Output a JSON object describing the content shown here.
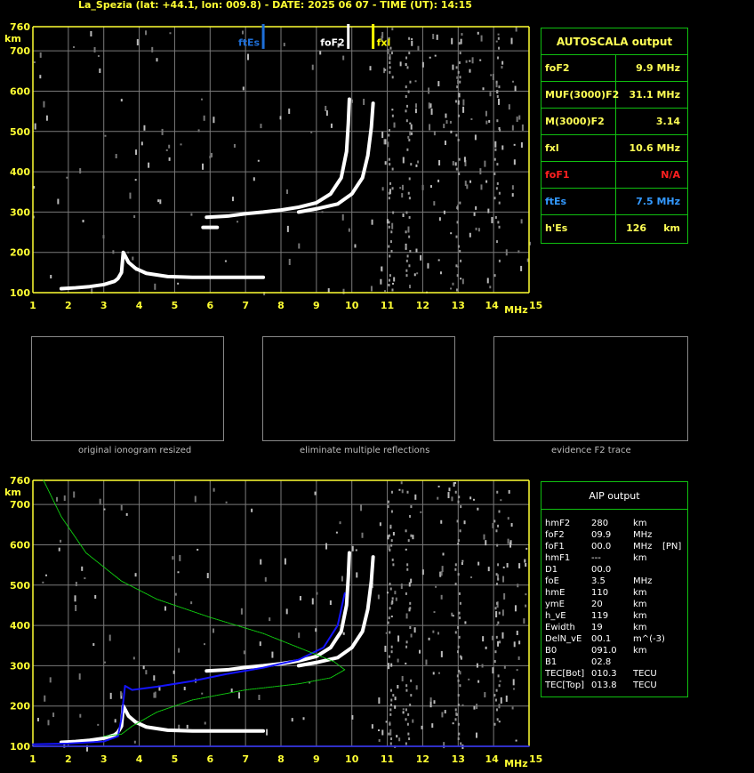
{
  "title": "La_Spezia (lat: +44.1, lon: 009.8) - DATE: 2025 06 07 - TIME (UT): 14:15",
  "colors": {
    "axis": "#ffff33",
    "grid": "#7a7a7a",
    "panel_border": "#10c010",
    "fte_marker": "#1e6fd9",
    "fof2_marker": "#ffffff",
    "fxl_marker": "#ffff00",
    "aip_profile": "#1414ff",
    "aip_model": "#10d010"
  },
  "axes": {
    "x_ticks": [
      "1",
      "2",
      "3",
      "4",
      "5",
      "6",
      "7",
      "8",
      "9",
      "10",
      "11",
      "12",
      "13",
      "14",
      "15"
    ],
    "x_unit": "MHz",
    "y_ticks": [
      "760",
      "700",
      "600",
      "500",
      "400",
      "300",
      "200",
      "100"
    ],
    "y_unit": "km"
  },
  "markers": {
    "ftEs": "ftEs",
    "foF2": "foF2",
    "fxl": "fxl"
  },
  "autoscala": {
    "title": "AUTOSCALA output",
    "rows": [
      {
        "label": "foF2",
        "value": "9.9 MHz",
        "color": "#ffff55"
      },
      {
        "label": "MUF(3000)F2",
        "value": "31.1 MHz",
        "color": "#ffff55"
      },
      {
        "label": "M(3000)F2",
        "value": "3.14",
        "color": "#ffff55"
      },
      {
        "label": "fxl",
        "value": "10.6 MHz",
        "color": "#ffff55"
      },
      {
        "label": "foF1",
        "value": "N/A",
        "color": "#ff2020"
      },
      {
        "label": "ftEs",
        "value": "7.5 MHz",
        "color": "#3399ff"
      },
      {
        "label": "h'Es",
        "value": "126",
        "unit": "km",
        "color": "#ffff55"
      }
    ]
  },
  "thumbnails": [
    {
      "caption": "original ionogram resized"
    },
    {
      "caption": "eliminate multiple reflections"
    },
    {
      "caption": "evidence F2 trace"
    }
  ],
  "aip": {
    "title": "AIP output",
    "rows": [
      {
        "label": "hmF2",
        "value": "280",
        "unit": "km",
        "extra": ""
      },
      {
        "label": "foF2",
        "value": "09.9",
        "unit": "MHz",
        "extra": ""
      },
      {
        "label": "foF1",
        "value": "00.0",
        "unit": "MHz",
        "extra": "[PN]"
      },
      {
        "label": "hmF1",
        "value": "---",
        "unit": "km",
        "extra": ""
      },
      {
        "label": "D1",
        "value": "00.0",
        "unit": "",
        "extra": ""
      },
      {
        "label": "foE",
        "value": "3.5",
        "unit": "MHz",
        "extra": ""
      },
      {
        "label": "hmE",
        "value": "110",
        "unit": "km",
        "extra": ""
      },
      {
        "label": "ymE",
        "value": "20",
        "unit": "km",
        "extra": ""
      },
      {
        "label": "h_vE",
        "value": "119",
        "unit": "km",
        "extra": ""
      },
      {
        "label": "Ewidth",
        "value": "19",
        "unit": "km",
        "extra": ""
      },
      {
        "label": "DelN_vE",
        "value": "00.1",
        "unit": "m^(-3)",
        "extra": ""
      },
      {
        "label": "B0",
        "value": "091.0",
        "unit": "km",
        "extra": ""
      },
      {
        "label": "B1",
        "value": "02.8",
        "unit": "",
        "extra": ""
      },
      {
        "label": "TEC[Bot]",
        "value": "010.3",
        "unit": "TECU",
        "extra": ""
      },
      {
        "label": "TEC[Top]",
        "value": "013.8",
        "unit": "TECU",
        "extra": ""
      }
    ]
  },
  "chart_data": [
    {
      "type": "scatter",
      "title": "",
      "xlabel": "MHz",
      "ylabel": "km",
      "xlim": [
        1,
        15
      ],
      "ylim": [
        100,
        760
      ],
      "grid": true,
      "series": [
        {
          "values": [
            [
              1.8,
              110
            ],
            [
              2.2,
              112
            ],
            [
              2.6,
              115
            ],
            [
              3.0,
              120
            ],
            [
              3.3,
              128
            ],
            [
              3.4,
              135
            ],
            [
              3.5,
              150
            ],
            [
              3.55,
              200
            ],
            [
              3.7,
              175
            ],
            [
              3.9,
              160
            ],
            [
              4.2,
              148
            ],
            [
              4.8,
              140
            ],
            [
              5.5,
              138
            ],
            [
              6.5,
              138
            ],
            [
              7.5,
              138
            ]
          ]
        },
        {
          "values": [
            [
              5.8,
              262
            ],
            [
              6.2,
              262
            ]
          ]
        },
        {
          "values": [
            [
              5.9,
              287
            ],
            [
              6.5,
              290
            ],
            [
              7.0,
              296
            ],
            [
              7.5,
              300
            ],
            [
              8.0,
              305
            ],
            [
              8.5,
              312
            ],
            [
              9.0,
              323
            ],
            [
              9.4,
              345
            ],
            [
              9.7,
              385
            ],
            [
              9.85,
              450
            ],
            [
              9.9,
              520
            ],
            [
              9.93,
              580
            ]
          ]
        },
        {
          "values": [
            [
              8.5,
              300
            ],
            [
              9.0,
              308
            ],
            [
              9.6,
              320
            ],
            [
              10.0,
              345
            ],
            [
              10.3,
              385
            ],
            [
              10.45,
              440
            ],
            [
              10.55,
              510
            ],
            [
              10.6,
              570
            ]
          ]
        }
      ],
      "markers": {
        "ftEs": 7.5,
        "foF2": 9.9,
        "fxl": 10.6
      }
    },
    {
      "type": "line",
      "title": "",
      "xlabel": "MHz",
      "ylabel": "km",
      "xlim": [
        1,
        15
      ],
      "ylim": [
        100,
        760
      ],
      "grid": true,
      "series": [
        {
          "values": [
            [
              1.8,
              110
            ],
            [
              2.2,
              112
            ],
            [
              2.6,
              115
            ],
            [
              3.0,
              120
            ],
            [
              3.3,
              128
            ],
            [
              3.4,
              135
            ],
            [
              3.5,
              150
            ],
            [
              3.55,
              200
            ],
            [
              3.7,
              175
            ],
            [
              3.9,
              160
            ],
            [
              4.2,
              148
            ],
            [
              4.8,
              140
            ],
            [
              5.5,
              138
            ],
            [
              6.5,
              138
            ],
            [
              7.5,
              138
            ]
          ]
        },
        {
          "values": [
            [
              5.9,
              287
            ],
            [
              6.5,
              290
            ],
            [
              7.0,
              296
            ],
            [
              7.5,
              300
            ],
            [
              8.0,
              305
            ],
            [
              8.5,
              312
            ],
            [
              9.0,
              323
            ],
            [
              9.4,
              345
            ],
            [
              9.7,
              385
            ],
            [
              9.85,
              450
            ],
            [
              9.9,
              520
            ],
            [
              9.93,
              580
            ]
          ]
        },
        {
          "values": [
            [
              8.5,
              300
            ],
            [
              9.0,
              308
            ],
            [
              9.6,
              320
            ],
            [
              10.0,
              345
            ],
            [
              10.3,
              385
            ],
            [
              10.45,
              440
            ],
            [
              10.55,
              510
            ],
            [
              10.6,
              570
            ]
          ]
        },
        {
          "values": [
            [
              1.0,
              105
            ],
            [
              2.0,
              107
            ],
            [
              3.0,
              112
            ],
            [
              3.4,
              125
            ],
            [
              3.5,
              170
            ],
            [
              3.6,
              250
            ],
            [
              3.8,
              240
            ],
            [
              4.5,
              248
            ],
            [
              5.5,
              262
            ],
            [
              6.5,
              280
            ],
            [
              7.5,
              295
            ],
            [
              8.5,
              315
            ],
            [
              9.2,
              345
            ],
            [
              9.6,
              400
            ],
            [
              9.8,
              480
            ]
          ]
        },
        {
          "values": [
            [
              1.0,
              100
            ],
            [
              15,
              100
            ]
          ]
        },
        {
          "values": [
            [
              1.3,
              760
            ],
            [
              1.8,
              670
            ],
            [
              2.5,
              580
            ],
            [
              3.5,
              510
            ],
            [
              4.5,
              465
            ],
            [
              6.0,
              420
            ],
            [
              7.5,
              380
            ],
            [
              8.5,
              345
            ],
            [
              9.5,
              310
            ],
            [
              9.8,
              290
            ],
            [
              9.4,
              270
            ],
            [
              8.5,
              255
            ],
            [
              7.0,
              240
            ],
            [
              5.5,
              215
            ],
            [
              4.5,
              185
            ],
            [
              3.8,
              150
            ],
            [
              3.5,
              130
            ],
            [
              3.0,
              125
            ]
          ]
        }
      ]
    }
  ]
}
